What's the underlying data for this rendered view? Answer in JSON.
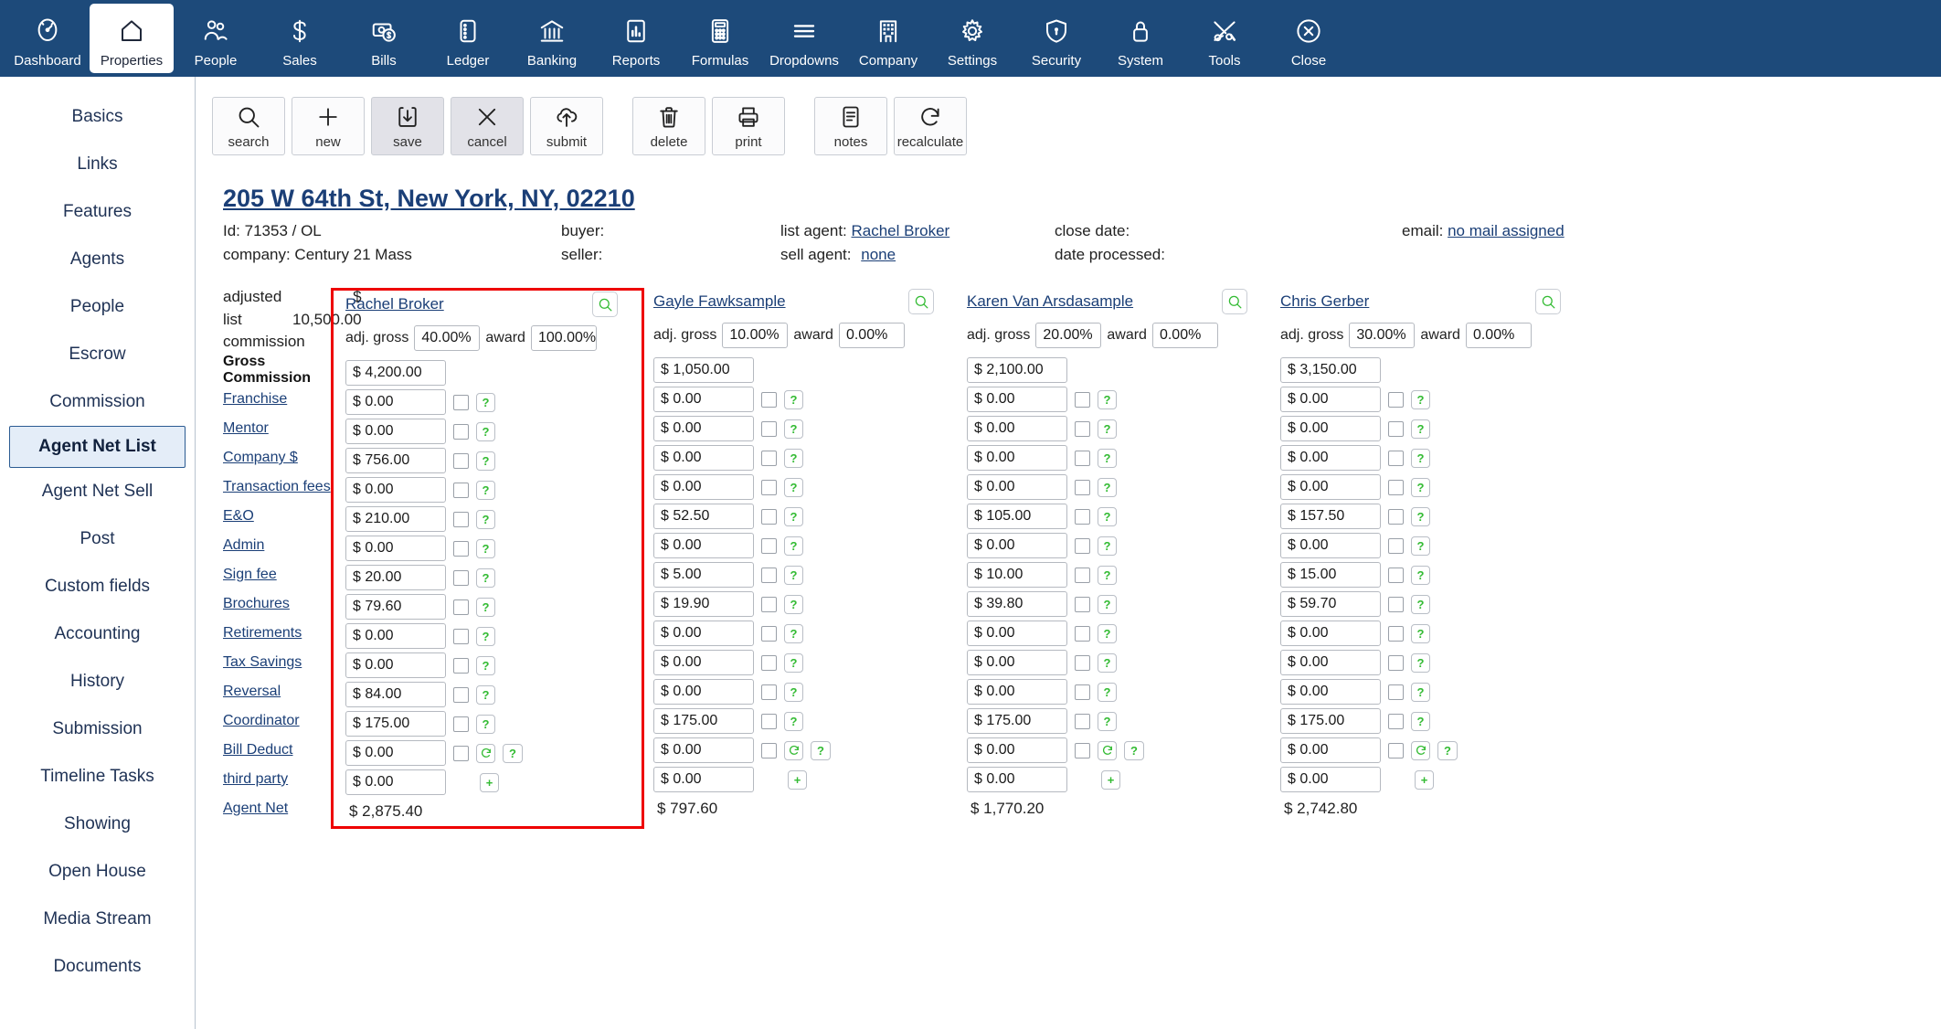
{
  "topnav": {
    "items": [
      {
        "label": "Dashboard",
        "icon": "gauge-icon",
        "active": false
      },
      {
        "label": "Properties",
        "icon": "house-icon",
        "active": true
      },
      {
        "label": "People",
        "icon": "people-icon",
        "active": false
      },
      {
        "label": "Sales",
        "icon": "dollar-icon",
        "active": false
      },
      {
        "label": "Bills",
        "icon": "bills-icon",
        "active": false
      },
      {
        "label": "Ledger",
        "icon": "ledger-icon",
        "active": false
      },
      {
        "label": "Banking",
        "icon": "bank-icon",
        "active": false
      },
      {
        "label": "Reports",
        "icon": "chart-icon",
        "active": false
      },
      {
        "label": "Formulas",
        "icon": "calculator-icon",
        "active": false
      },
      {
        "label": "Dropdowns",
        "icon": "menu-lines-icon",
        "active": false
      },
      {
        "label": "Company",
        "icon": "building-icon",
        "active": false
      },
      {
        "label": "Settings",
        "icon": "gear-icon",
        "active": false
      },
      {
        "label": "Security",
        "icon": "shield-lock-icon",
        "active": false
      },
      {
        "label": "System",
        "icon": "lock-icon",
        "active": false
      },
      {
        "label": "Tools",
        "icon": "tools-icon",
        "active": false
      },
      {
        "label": "Close",
        "icon": "close-circle-icon",
        "active": false
      }
    ]
  },
  "sidebar": {
    "items": [
      {
        "label": "Basics",
        "active": false
      },
      {
        "label": "Links",
        "active": false
      },
      {
        "label": "Features",
        "active": false
      },
      {
        "label": "Agents",
        "active": false
      },
      {
        "label": "People",
        "active": false
      },
      {
        "label": "Escrow",
        "active": false
      },
      {
        "label": "Commission",
        "active": false
      },
      {
        "label": "Agent Net List",
        "active": true
      },
      {
        "label": "Agent Net Sell",
        "active": false
      },
      {
        "label": "Post",
        "active": false
      },
      {
        "label": "Custom fields",
        "active": false
      },
      {
        "label": "Accounting",
        "active": false
      },
      {
        "label": "History",
        "active": false
      },
      {
        "label": "Submission",
        "active": false
      },
      {
        "label": "Timeline Tasks",
        "active": false
      },
      {
        "label": "Showing",
        "active": false
      },
      {
        "label": "Open House",
        "active": false
      },
      {
        "label": "Media Stream",
        "active": false
      },
      {
        "label": "Documents",
        "active": false
      }
    ]
  },
  "toolbar": {
    "buttons": [
      {
        "label": "search",
        "icon": "magnifier-icon",
        "pressed": false
      },
      {
        "label": "new",
        "icon": "plus-icon",
        "pressed": false
      },
      {
        "label": "save",
        "icon": "save-download-icon",
        "pressed": true
      },
      {
        "label": "cancel",
        "icon": "x-icon",
        "pressed": true
      },
      {
        "label": "submit",
        "icon": "cloud-upload-icon",
        "pressed": false
      }
    ],
    "buttons2": [
      {
        "label": "delete",
        "icon": "trash-icon",
        "pressed": false
      },
      {
        "label": "print",
        "icon": "printer-icon",
        "pressed": false
      }
    ],
    "buttons3": [
      {
        "label": "notes",
        "icon": "notes-icon",
        "pressed": false
      },
      {
        "label": "recalculate",
        "icon": "refresh-icon",
        "pressed": false
      }
    ]
  },
  "property": {
    "title": "205 W 64th St, New York, NY, 02210",
    "id_label": "Id: 71353 / OL",
    "company_label": "company: Century 21 Mass",
    "buyer_label": "buyer:",
    "buyer_value": "",
    "seller_label": "seller:",
    "seller_value": "",
    "list_agent_label": "list agent:",
    "list_agent_value": "Rachel Broker",
    "sell_agent_label": "sell agent:",
    "sell_agent_value": "none",
    "close_date_label": "close date:",
    "close_date_value": "",
    "date_processed_label": "date processed:",
    "date_processed_value": "",
    "email_label": "email:",
    "email_value": "no mail assigned"
  },
  "commission": {
    "adjusted_label_line1": "adjusted",
    "adjusted_label_line2": "list",
    "adjusted_label_line3": "commission",
    "adjusted_currency": "$",
    "adjusted_amount": "10,500.00",
    "gross_commission_label": "Gross Commission",
    "adj_gross_label": "adj. gross",
    "award_label": "award",
    "rows": [
      {
        "label": "Franchise",
        "action": "question"
      },
      {
        "label": "Mentor",
        "action": "question"
      },
      {
        "label": "Company $",
        "action": "question"
      },
      {
        "label": "Transaction fees",
        "action": "question"
      },
      {
        "label": "E&O",
        "action": "question"
      },
      {
        "label": "Admin",
        "action": "question"
      },
      {
        "label": "Sign fee",
        "action": "question"
      },
      {
        "label": "Brochures",
        "action": "question"
      },
      {
        "label": "Retirements",
        "action": "question"
      },
      {
        "label": "Tax Savings",
        "action": "question"
      },
      {
        "label": "Reversal",
        "action": "question"
      },
      {
        "label": "Coordinator",
        "action": "question"
      },
      {
        "label": "Bill Deduct",
        "action": "refresh"
      },
      {
        "label": "third party",
        "action": "plus"
      }
    ],
    "agent_net_label": "Agent Net",
    "agents": [
      {
        "name": "Rachel Broker",
        "adj_gross": "40.00%",
        "award": "100.00%",
        "gross_commission": "$ 4,200.00",
        "highlighted": true,
        "values": [
          "$ 0.00",
          "$ 0.00",
          "$ 756.00",
          "$ 0.00",
          "$ 210.00",
          "$ 0.00",
          "$ 20.00",
          "$ 79.60",
          "$ 0.00",
          "$ 0.00",
          "$ 84.00",
          "$ 175.00",
          "$ 0.00",
          "$ 0.00"
        ],
        "agent_net": "$ 2,875.40"
      },
      {
        "name": "Gayle Fawksample",
        "adj_gross": "10.00%",
        "award": "0.00%",
        "gross_commission": "$ 1,050.00",
        "highlighted": false,
        "values": [
          "$ 0.00",
          "$ 0.00",
          "$ 0.00",
          "$ 0.00",
          "$ 52.50",
          "$ 0.00",
          "$ 5.00",
          "$ 19.90",
          "$ 0.00",
          "$ 0.00",
          "$ 0.00",
          "$ 175.00",
          "$ 0.00",
          "$ 0.00"
        ],
        "agent_net": "$ 797.60"
      },
      {
        "name": "Karen Van Arsdasample",
        "adj_gross": "20.00%",
        "award": "0.00%",
        "gross_commission": "$ 2,100.00",
        "highlighted": false,
        "values": [
          "$ 0.00",
          "$ 0.00",
          "$ 0.00",
          "$ 0.00",
          "$ 105.00",
          "$ 0.00",
          "$ 10.00",
          "$ 39.80",
          "$ 0.00",
          "$ 0.00",
          "$ 0.00",
          "$ 175.00",
          "$ 0.00",
          "$ 0.00"
        ],
        "agent_net": "$ 1,770.20"
      },
      {
        "name": "Chris Gerber",
        "adj_gross": "30.00%",
        "award": "0.00%",
        "gross_commission": "$ 3,150.00",
        "highlighted": false,
        "values": [
          "$ 0.00",
          "$ 0.00",
          "$ 0.00",
          "$ 0.00",
          "$ 157.50",
          "$ 0.00",
          "$ 15.00",
          "$ 59.70",
          "$ 0.00",
          "$ 0.00",
          "$ 0.00",
          "$ 175.00",
          "$ 0.00",
          "$ 0.00"
        ],
        "agent_net": "$ 2,742.80"
      }
    ]
  },
  "colors": {
    "nav_bg": "#1d4a7a",
    "link": "#1b3f77",
    "highlight_border": "#ee0000",
    "accent_green": "#33bb33"
  }
}
